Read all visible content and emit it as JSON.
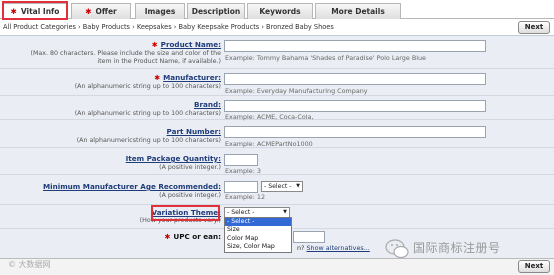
{
  "tabs": [
    {
      "label": "Vital Info",
      "required": true
    },
    {
      "label": "Offer",
      "required": true
    },
    {
      "label": "Images",
      "required": false
    },
    {
      "label": "Description",
      "required": false
    },
    {
      "label": "Keywords",
      "required": false
    },
    {
      "label": "More Details",
      "required": false
    }
  ],
  "breadcrumb": "All Product Categories › Baby Products › Keepsakes › Baby Keepsake Products › Bronzed Baby Shoes",
  "next_label": "Next",
  "required_mark": "✱",
  "fields": {
    "product_name": {
      "label": "Product Name:",
      "hint": "(Max. 80 characters. Please include the size and color of the item in the Product Name, if available.)",
      "value": "",
      "example": "Example:  Tommy Bahama 'Shades of Paradise' Polo Large Blue"
    },
    "manufacturer": {
      "label": "Manufacturer:",
      "hint": "(An alphanumeric string up to 100 characters)",
      "value": "",
      "example": "Example:  Everyday Manufacturing Company"
    },
    "brand": {
      "label": "Brand:",
      "hint": "(An alphanumeric string up to 100 characters)",
      "value": "",
      "example": "Example:  ACME, Coca-Cola,"
    },
    "part_number": {
      "label": "Part Number:",
      "hint": "(An alphanumericstring up to 100 characters)",
      "value": "",
      "example": "Example:  ACMEPartNo1000"
    },
    "item_package_quantity": {
      "label": "Item Package Quantity:",
      "hint": "(A positive integer.)",
      "value": "",
      "example": "Example:  3"
    },
    "min_age": {
      "label": "Minimum Manufacturer Age Recommended:",
      "hint": "(A positive integer.)",
      "value": "",
      "unit_select": "- Select -",
      "example": "Example:  12"
    },
    "variation_theme": {
      "label": "Variation Theme:",
      "hint": "(How your products vary.)",
      "selected": "- Select -",
      "options": [
        "- Select -",
        "Size",
        "Color Map",
        "Size, Color Map"
      ]
    },
    "upc": {
      "label": "UPC or ean:",
      "value": "",
      "link_prefix": "n?",
      "link_text": "Show alternatives..."
    }
  },
  "watermark_left": "© 大数据网",
  "watermark_right": "国际商标注册号"
}
